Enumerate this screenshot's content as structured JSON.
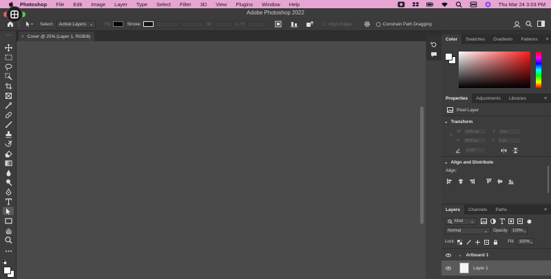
{
  "menubar": {
    "app_name": "Photoshop",
    "items": [
      "File",
      "Edit",
      "Image",
      "Layer",
      "Type",
      "Select",
      "Filter",
      "3D",
      "View",
      "Plugins",
      "Window",
      "Help"
    ],
    "datetime": "Thu Mar 24  3:03 PM",
    "bg_color": "#e6a5d3"
  },
  "window": {
    "title": "Adobe Photoshop 2022"
  },
  "options_bar": {
    "select_label": "Select:",
    "select_value": "Active Layers",
    "fill_label": "Fill:",
    "stroke_label": "Stroke:",
    "w_label": "W:",
    "h_label": "H:",
    "align_edges_label": "Align Edges",
    "constrain_label": "Constrain Path Dragging"
  },
  "document": {
    "tab_title": "Cover @ 25% (Layer 1, RGB/8)",
    "close_glyph": "×"
  },
  "color_panel": {
    "tabs": [
      "Color",
      "Swatches",
      "Gradients",
      "Patterns"
    ],
    "active_tab": "Color"
  },
  "properties_panel": {
    "tabs": [
      "Properties",
      "Adjustments",
      "Libraries"
    ],
    "layer_type": "Pixel Layer",
    "transform_title": "Transform",
    "w_label": "W",
    "w_value": "5550 px",
    "h_label": "H",
    "h_value": "3500 px",
    "x_label": "X",
    "x_value": "0 px",
    "y_label": "Y",
    "y_value": "0 px",
    "angle_value": "0.00°",
    "align_title": "Align and Distribute",
    "align_label": "Align:"
  },
  "layers_panel": {
    "tabs": [
      "Layers",
      "Channels",
      "Paths"
    ],
    "kind_label": "Kind",
    "blend_mode": "Normal",
    "opacity_label": "Opacity:",
    "opacity_value": "100%",
    "lock_label": "Lock:",
    "fill_label": "Fill:",
    "fill_value": "100%",
    "layers": [
      {
        "name": "Artboard 1"
      },
      {
        "name": "Layer 1"
      }
    ]
  }
}
